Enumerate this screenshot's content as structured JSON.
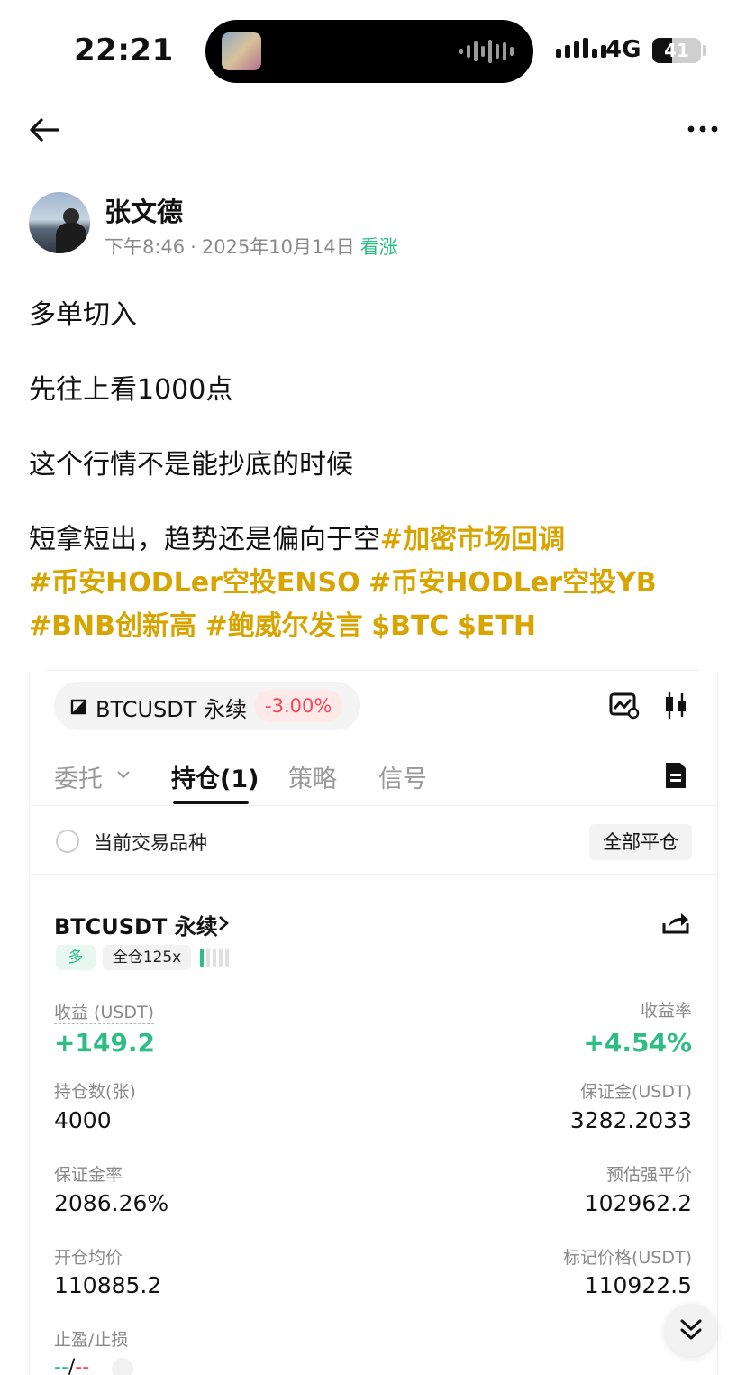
{
  "status_bar": {
    "time": "22:21",
    "network": "4G",
    "battery": "41",
    "battery_level": 0.41
  },
  "author": {
    "name": "张文德",
    "time": "下午8:46",
    "separator": "·",
    "date": "2025年10月14日",
    "sentiment": "看涨"
  },
  "post": {
    "line1": "多单切入",
    "line2": "先往上看1000点",
    "line3": "这个行情不是能抄底的时候",
    "line4_text": "短拿短出，趋势还是偏向于空",
    "tag1": "#加密市场回调",
    "tag2": "#币安HODLer空投ENSO",
    "tag3": "#币安HODLer空投YB",
    "tag4": "#BNB创新高",
    "tag5": "#鲍威尔发言",
    "tag6": "$BTC",
    "tag7": "$ETH"
  },
  "card": {
    "pair": "BTCUSDT 永续",
    "change": "-3.00%",
    "tabs": [
      "委托",
      "持仓(1)",
      "策略",
      "信号"
    ],
    "filter_label": "当前交易品种",
    "close_all_label": "全部平仓",
    "position": {
      "name": "BTCUSDT 永续",
      "side": "多",
      "leverage": "全仓125x",
      "pnl_label": "收益 (USDT)",
      "pnl_value": "+149.2",
      "roe_label": "收益率",
      "roe_value": "+4.54%",
      "size_label": "持仓数(张)",
      "size_value": "4000",
      "margin_label": "保证金(USDT)",
      "margin_value": "3282.2033",
      "margin_ratio_label": "保证金率",
      "margin_ratio_value": "2086.26%",
      "liq_label": "预估强平价",
      "liq_value": "102962.2",
      "entry_label": "开仓均价",
      "entry_value": "110885.2",
      "mark_label": "标记价格(USDT)",
      "mark_value": "110922.5",
      "tpsl_label": "止盈/止损",
      "tpsl_tp": "--",
      "tpsl_sep": "/",
      "tpsl_sl": "--"
    }
  },
  "colors": {
    "tag": "#d8a400",
    "up": "#2ebd85",
    "down": "#f6465d"
  },
  "icons": [
    "back-arrow-icon",
    "more-icon",
    "chart-settings-icon",
    "candlestick-icon",
    "document-icon",
    "share-icon",
    "double-chevron-down-icon"
  ]
}
